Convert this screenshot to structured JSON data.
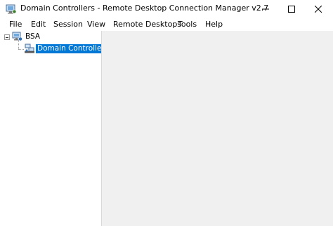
{
  "window": {
    "title": "Domain Controllers - Remote Desktop Connection Manager v2.7",
    "app_icon": "rdcman-app-icon",
    "controls": {
      "minimize_icon": "minimize-icon",
      "maximize_icon": "maximize-icon",
      "close_icon": "close-icon"
    }
  },
  "menubar": {
    "items": [
      {
        "label": "File"
      },
      {
        "label": "Edit"
      },
      {
        "label": "Session"
      },
      {
        "label": "View"
      },
      {
        "label": "Remote Desktops"
      },
      {
        "label": "Tools"
      },
      {
        "label": "Help"
      }
    ]
  },
  "tree": {
    "root": {
      "label": "BSA",
      "icon": "file-group-icon",
      "expanded": true
    },
    "children": [
      {
        "label": "Domain Controllers",
        "icon": "server-group-icon",
        "selected": true
      }
    ]
  },
  "colors": {
    "selection": "#0078d7",
    "content_background": "#f0f0f0"
  }
}
